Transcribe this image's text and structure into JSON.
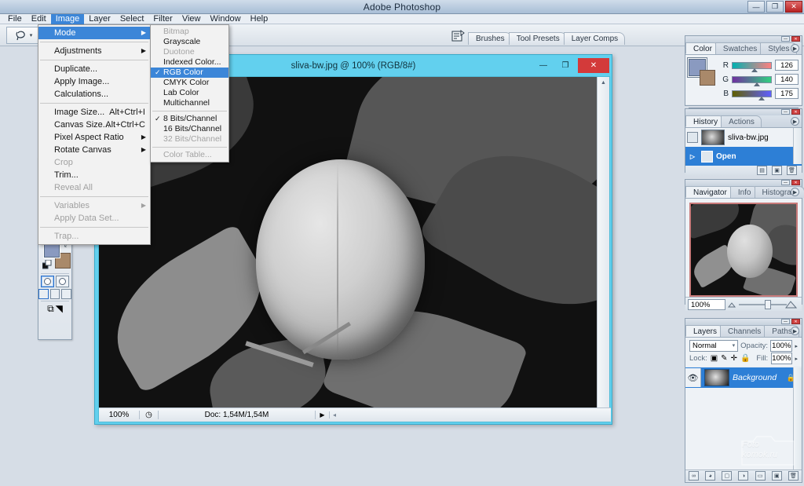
{
  "window": {
    "title": "Adobe Photoshop",
    "minimize": "—",
    "maximize": "❐",
    "close": "✕"
  },
  "menubar": {
    "items": [
      {
        "label": "File",
        "active": false
      },
      {
        "label": "Edit",
        "active": false
      },
      {
        "label": "Image",
        "active": true
      },
      {
        "label": "Layer",
        "active": false
      },
      {
        "label": "Select",
        "active": false
      },
      {
        "label": "Filter",
        "active": false
      },
      {
        "label": "View",
        "active": false
      },
      {
        "label": "Window",
        "active": false
      },
      {
        "label": "Help",
        "active": false
      }
    ]
  },
  "options_bar": {
    "tool_icon": "lasso-icon",
    "tool_dropdown": "▾",
    "palette_well_icon": "palette-well-icon",
    "tabs": [
      "Brushes",
      "Tool Presets",
      "Layer Comps"
    ]
  },
  "image_menu": {
    "items": [
      {
        "label": "Mode",
        "submenu": true,
        "selected": true,
        "disabled": false,
        "accel": ""
      },
      {
        "sep": true
      },
      {
        "label": "Adjustments",
        "submenu": true,
        "selected": false,
        "disabled": false,
        "accel": ""
      },
      {
        "sep": true
      },
      {
        "label": "Duplicate...",
        "submenu": false,
        "selected": false,
        "disabled": false,
        "accel": ""
      },
      {
        "label": "Apply Image...",
        "submenu": false,
        "selected": false,
        "disabled": false,
        "accel": ""
      },
      {
        "label": "Calculations...",
        "submenu": false,
        "selected": false,
        "disabled": false,
        "accel": ""
      },
      {
        "sep": true
      },
      {
        "label": "Image Size...",
        "submenu": false,
        "selected": false,
        "disabled": false,
        "accel": "Alt+Ctrl+I"
      },
      {
        "label": "Canvas Size...",
        "submenu": false,
        "selected": false,
        "disabled": false,
        "accel": "Alt+Ctrl+C"
      },
      {
        "label": "Pixel Aspect Ratio",
        "submenu": true,
        "selected": false,
        "disabled": false,
        "accel": ""
      },
      {
        "label": "Rotate Canvas",
        "submenu": true,
        "selected": false,
        "disabled": false,
        "accel": ""
      },
      {
        "label": "Crop",
        "submenu": false,
        "selected": false,
        "disabled": true,
        "accel": ""
      },
      {
        "label": "Trim...",
        "submenu": false,
        "selected": false,
        "disabled": false,
        "accel": ""
      },
      {
        "label": "Reveal All",
        "submenu": false,
        "selected": false,
        "disabled": true,
        "accel": ""
      },
      {
        "sep": true
      },
      {
        "label": "Variables",
        "submenu": true,
        "selected": false,
        "disabled": true,
        "accel": ""
      },
      {
        "label": "Apply Data Set...",
        "submenu": false,
        "selected": false,
        "disabled": true,
        "accel": ""
      },
      {
        "sep": true
      },
      {
        "label": "Trap...",
        "submenu": false,
        "selected": false,
        "disabled": true,
        "accel": ""
      }
    ]
  },
  "mode_submenu": {
    "items": [
      {
        "label": "Bitmap",
        "disabled": true,
        "checked": false,
        "selected": false
      },
      {
        "label": "Grayscale",
        "disabled": false,
        "checked": false,
        "selected": false
      },
      {
        "label": "Duotone",
        "disabled": true,
        "checked": false,
        "selected": false
      },
      {
        "label": "Indexed Color...",
        "disabled": false,
        "checked": false,
        "selected": false
      },
      {
        "label": "RGB Color",
        "disabled": false,
        "checked": true,
        "selected": true
      },
      {
        "label": "CMYK Color",
        "disabled": false,
        "checked": false,
        "selected": false
      },
      {
        "label": "Lab Color",
        "disabled": false,
        "checked": false,
        "selected": false
      },
      {
        "label": "Multichannel",
        "disabled": false,
        "checked": false,
        "selected": false
      },
      {
        "sep": true
      },
      {
        "label": "8 Bits/Channel",
        "disabled": false,
        "checked": true,
        "selected": false
      },
      {
        "label": "16 Bits/Channel",
        "disabled": false,
        "checked": false,
        "selected": false
      },
      {
        "label": "32 Bits/Channel",
        "disabled": true,
        "checked": false,
        "selected": false
      },
      {
        "sep": true
      },
      {
        "label": "Color Table...",
        "disabled": true,
        "checked": false,
        "selected": false
      }
    ]
  },
  "toolbox": {
    "tools": [
      {
        "name": "move-tool",
        "glyph": "➤",
        "has_tri": true
      },
      {
        "name": "type-tool",
        "glyph": "T",
        "has_tri": true
      },
      {
        "name": "pen-tool",
        "glyph": "✎",
        "has_tri": true
      },
      {
        "name": "lasso-tool",
        "glyph": "◠",
        "has_tri": true
      },
      {
        "name": "notes-tool",
        "glyph": "▤",
        "has_tri": true
      },
      {
        "name": "eyedropper-tool",
        "glyph": "⟋",
        "has_tri": true
      },
      {
        "name": "hand-tool",
        "glyph": "✋",
        "has_tri": false
      },
      {
        "name": "zoom-tool",
        "glyph": "🔍",
        "has_tri": false
      }
    ],
    "foreground_color": "#8a9ac0",
    "background_color": "#a9896a",
    "swap_icon": "↰",
    "default_icon": "▣"
  },
  "document": {
    "title": "sliva-bw.jpg @ 100% (RGB/8#)",
    "minimize": "—",
    "maximize": "❐",
    "close": "✕",
    "status": {
      "zoom": "100%",
      "thumb_icon": "preview-icon",
      "doc_size": "Doc: 1,54M/1,54M",
      "arrow": "▶",
      "resize": "◂"
    }
  },
  "panels": {
    "color": {
      "tabs": [
        "Color",
        "Swatches",
        "Styles"
      ],
      "active_tab": "Color",
      "menu_icon": "▶",
      "channels": [
        {
          "label": "R",
          "value": "126",
          "gradient": "linear-gradient(90deg,#00b0b0,#ff8080)"
        },
        {
          "label": "G",
          "value": "140",
          "gradient": "linear-gradient(90deg,#7030a0,#30d080)"
        },
        {
          "label": "B",
          "value": "175",
          "gradient": "linear-gradient(90deg,#606000,#6060ff)"
        }
      ],
      "thumb_pos": [
        "49%",
        "55%",
        "68%"
      ]
    },
    "history": {
      "tabs": [
        "History",
        "Actions"
      ],
      "active_tab": "History",
      "menu_icon": "▶",
      "snapshot": "sliva-bw.jpg",
      "states": [
        {
          "label": "Open",
          "selected": true
        }
      ],
      "footer_icons": [
        "new-document-icon",
        "new-snapshot-icon",
        "delete-icon"
      ]
    },
    "navigator": {
      "tabs": [
        "Navigator",
        "Info",
        "Histogram"
      ],
      "active_tab": "Navigator",
      "menu_icon": "▶",
      "zoom": "100%",
      "zoom_out_icon": "small-mountain-icon",
      "zoom_in_icon": "large-mountain-icon"
    },
    "layers": {
      "tabs": [
        "Layers",
        "Channels",
        "Paths"
      ],
      "active_tab": "Layers",
      "menu_icon": "▶",
      "blend_mode": "Normal",
      "blend_caret": "▾",
      "opacity_label": "Opacity:",
      "opacity_value": "100%",
      "opacity_caret": "▸",
      "lock_label": "Lock:",
      "lock_icons": [
        "lock-transparency-icon",
        "lock-image-icon",
        "lock-position-icon",
        "lock-all-icon"
      ],
      "fill_label": "Fill:",
      "fill_value": "100%",
      "fill_caret": "▸",
      "items": [
        {
          "name": "Background",
          "visible": true,
          "locked": true,
          "selected": true
        }
      ],
      "footer_icons": [
        "link-icon",
        "layer-style-icon",
        "mask-icon",
        "adjustment-icon",
        "group-icon",
        "new-layer-icon",
        "delete-layer-icon"
      ]
    }
  },
  "watermark": {
    "line1": "Foto",
    "line2": "komok.ru"
  }
}
